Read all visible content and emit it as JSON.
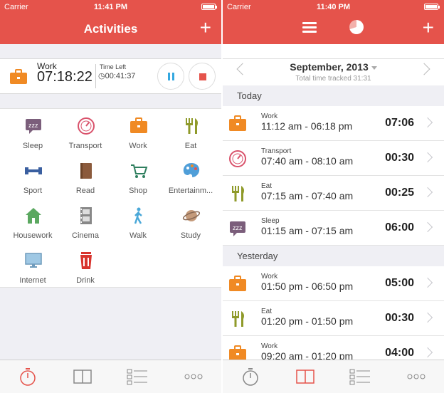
{
  "left": {
    "status": {
      "carrier": "Carrier",
      "time": "11:41 PM"
    },
    "nav": {
      "title": "Activities",
      "add": "+"
    },
    "timer": {
      "activity": "Work",
      "elapsed": "07:18:22",
      "time_left_label": "Time Left",
      "time_left": "00:41:37"
    },
    "activities": [
      {
        "label": "Sleep",
        "icon": "sleep-icon"
      },
      {
        "label": "Transport",
        "icon": "speedometer-icon"
      },
      {
        "label": "Work",
        "icon": "briefcase-icon"
      },
      {
        "label": "Eat",
        "icon": "fork-knife-icon"
      },
      {
        "label": "Sport",
        "icon": "dumbbell-icon"
      },
      {
        "label": "Read",
        "icon": "book-icon"
      },
      {
        "label": "Shop",
        "icon": "cart-icon"
      },
      {
        "label": "Entertainm...",
        "icon": "palette-icon"
      },
      {
        "label": "Housework",
        "icon": "house-icon"
      },
      {
        "label": "Cinema",
        "icon": "film-icon"
      },
      {
        "label": "Walk",
        "icon": "walking-person-icon"
      },
      {
        "label": "Study",
        "icon": "planet-icon"
      },
      {
        "label": "Internet",
        "icon": "monitor-icon"
      },
      {
        "label": "Drink",
        "icon": "cup-icon"
      }
    ]
  },
  "right": {
    "status": {
      "carrier": "Carrier",
      "time": "11:40 PM"
    },
    "nav": {
      "add": "+"
    },
    "month": {
      "title": "September, 2013",
      "subtitle": "Total time tracked 31:31"
    },
    "sections": [
      {
        "title": "Today",
        "rows": [
          {
            "activity": "Work",
            "range": "11:12 am - 06:18 pm",
            "duration": "07:06",
            "icon": "briefcase-icon"
          },
          {
            "activity": "Transport",
            "range": "07:40 am - 08:10 am",
            "duration": "00:30",
            "icon": "speedometer-icon"
          },
          {
            "activity": "Eat",
            "range": "07:15 am - 07:40 am",
            "duration": "00:25",
            "icon": "fork-knife-icon"
          },
          {
            "activity": "Sleep",
            "range": "01:15 am - 07:15 am",
            "duration": "06:00",
            "icon": "sleep-icon"
          }
        ]
      },
      {
        "title": "Yesterday",
        "rows": [
          {
            "activity": "Work",
            "range": "01:50 pm - 06:50 pm",
            "duration": "05:00",
            "icon": "briefcase-icon"
          },
          {
            "activity": "Eat",
            "range": "01:20 pm - 01:50 pm",
            "duration": "00:30",
            "icon": "fork-knife-icon"
          },
          {
            "activity": "Work",
            "range": "09:20 am - 01:20 pm",
            "duration": "04:00",
            "icon": "briefcase-icon"
          }
        ]
      }
    ]
  },
  "colors": {
    "accent": "#e5534b",
    "work": "#f08a24",
    "eat": "#8f9a2a",
    "sleep": "#7b5e7b",
    "transport": "#d9526b"
  },
  "tabs": [
    "stopwatch-icon",
    "log-book-icon",
    "list-icon",
    "more-icon"
  ]
}
